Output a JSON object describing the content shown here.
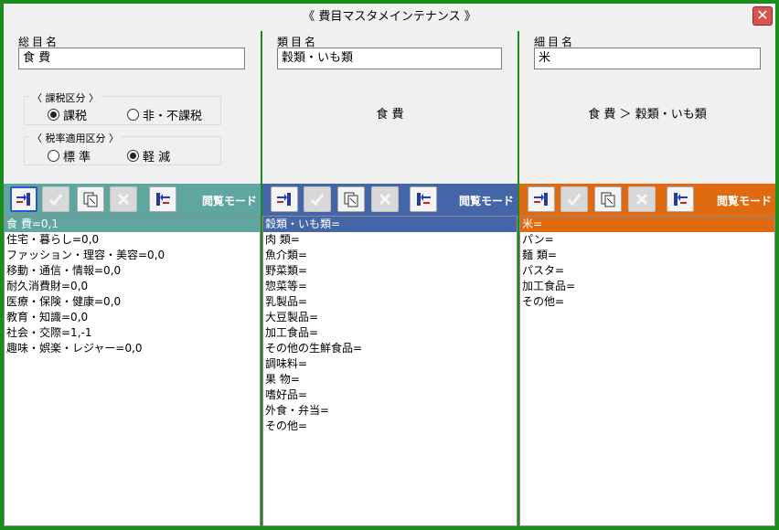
{
  "window": {
    "title": "《 費目マスタメインテナンス 》",
    "close_glyph": "✕"
  },
  "col1": {
    "label": "総目名",
    "value": "食 費",
    "tax_group": {
      "title": "〈 課税区分 〉",
      "opt1": "課税",
      "opt2": "非・不課税",
      "selected": 1
    },
    "rate_group": {
      "title": "〈 税率適用区分 〉",
      "opt1": "標 準",
      "opt2": "軽 減",
      "selected": 2
    },
    "toolbar_color": "#5fa6a0",
    "mode": "閲覧モード",
    "items": [
      "食 費=0,1",
      "住宅・暮らし=0,0",
      "ファッション・理容・美容=0,0",
      "移動・通信・情報=0,0",
      "耐久消費財=0,0",
      "医療・保険・健康=0,0",
      "教育・知識=0,0",
      "社会・交際=1,-1",
      "趣味・娯楽・レジャー=0,0"
    ]
  },
  "col2": {
    "label": "類目名",
    "value": "穀類・いも類",
    "path": "食 費",
    "toolbar_color": "#4466a8",
    "mode": "閲覧モード",
    "items": [
      "穀類・いも類=",
      "肉 類=",
      "魚介類=",
      "野菜類=",
      "惣菜等=",
      "乳製品=",
      "大豆製品=",
      "加工食品=",
      "その他の生鮮食品=",
      "調味料=",
      "果 物=",
      "嗜好品=",
      "外食・弁当=",
      "その他="
    ]
  },
  "col3": {
    "label": "細目名",
    "value": "米",
    "path": "食 費 ＞ 穀類・いも類",
    "toolbar_color": "#e06a10",
    "mode": "閲覧モード",
    "items": [
      "米=",
      "パン=",
      "麺 類=",
      "パスタ=",
      "加工食品=",
      "その他="
    ]
  },
  "icons": [
    "add-row-icon",
    "check-icon",
    "copy-edit-icon",
    "delete-icon",
    "remove-row-icon"
  ]
}
